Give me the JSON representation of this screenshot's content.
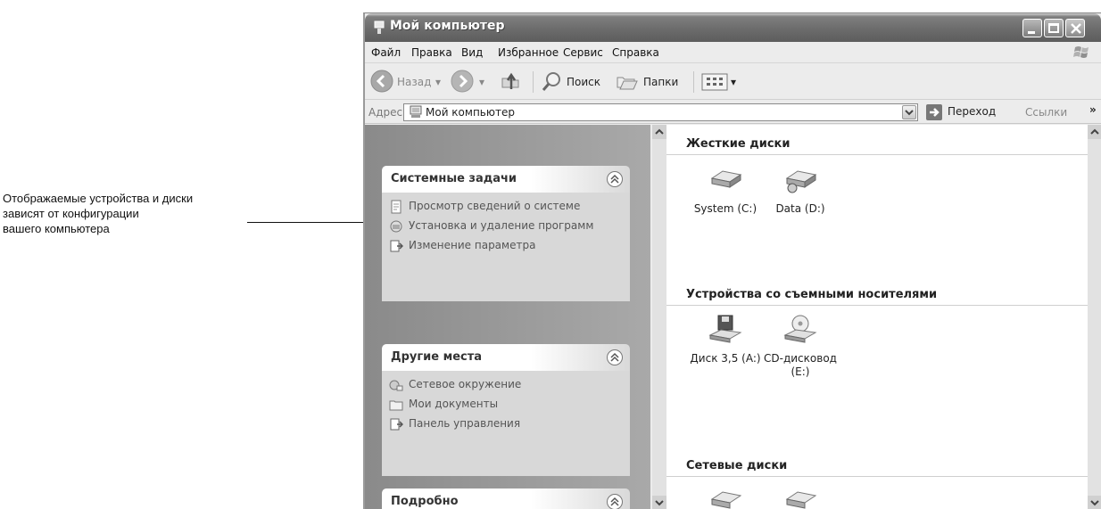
{
  "annotation": {
    "lines": [
      "Отображаемые устройства и диски",
      "зависят от конфигурации",
      "вашего компьютера"
    ]
  },
  "window": {
    "title": "Мой компьютер"
  },
  "menu": {
    "items": [
      "Файл",
      "Правка",
      "Вид",
      "Избранное",
      "Сервис",
      "Справка"
    ]
  },
  "toolbar": {
    "back": "Назад",
    "search": "Поиск",
    "folders": "Папки"
  },
  "address": {
    "label": "Адрес:",
    "value": "Мой компьютер",
    "go": "Переход",
    "links": "Ссылки",
    "more": "»"
  },
  "sidebar": {
    "system_tasks": {
      "title": "Системные задачи",
      "items": [
        "Просмотр сведений о системе",
        "Установка и удаление программ",
        "Изменение параметра"
      ]
    },
    "other_places": {
      "title": "Другие места",
      "items": [
        "Сетевое окружение",
        "Мои документы",
        "Панель управления"
      ]
    },
    "details": {
      "title": "Подробно"
    }
  },
  "content": {
    "hard_disks": {
      "title": "Жесткие диски",
      "items": [
        "System (C:)",
        "Data (D:)"
      ]
    },
    "removable": {
      "title": "Устройства со съемными носителями",
      "items": [
        "Диск 3,5 (A:)",
        "CD-дисковод (E:)"
      ]
    },
    "network": {
      "title": "Сетевые диски"
    }
  }
}
